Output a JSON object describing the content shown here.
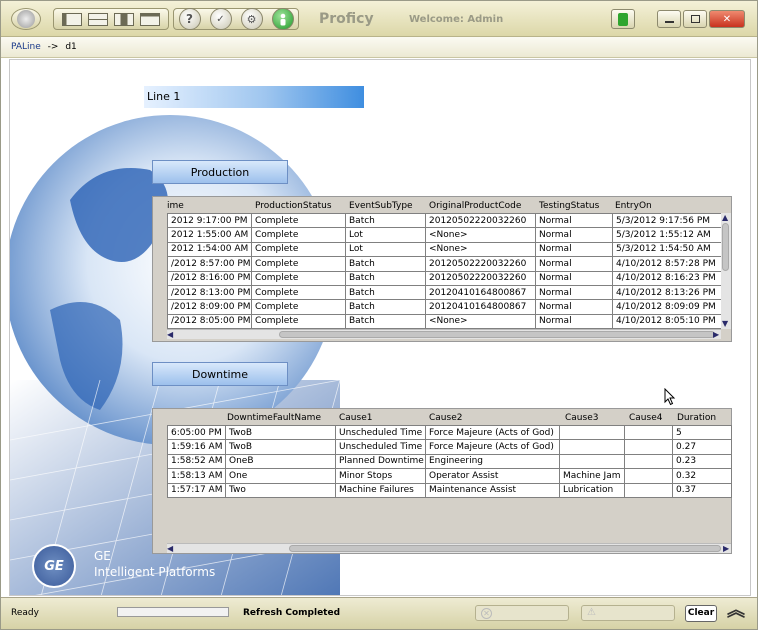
{
  "titlebar": {
    "brand": "Proficy",
    "welcome": "Welcome: Admin",
    "buttons": {
      "help": "?",
      "check": "✓",
      "gear": "⚙"
    }
  },
  "breadcrumb": {
    "root": "PALine",
    "separator": "->",
    "current": "d1"
  },
  "line_banner": "Line 1",
  "production": {
    "title": "Production",
    "columns": [
      "ime",
      "ProductionStatus",
      "EventSubType",
      "OriginalProductCode",
      "TestingStatus",
      "EntryOn"
    ],
    "rows": [
      [
        "2012 9:17:00 PM",
        "Complete",
        "Batch",
        "20120502220032260",
        "Normal",
        "5/3/2012 9:17:56 PM"
      ],
      [
        "2012 1:55:00 AM",
        "Complete",
        "Lot",
        "<None>",
        "Normal",
        "5/3/2012 1:55:12 AM"
      ],
      [
        "2012 1:54:00 AM",
        "Complete",
        "Lot",
        "<None>",
        "Normal",
        "5/3/2012 1:54:50 AM"
      ],
      [
        "/2012 8:57:00 PM",
        "Complete",
        "Batch",
        "20120502220032260",
        "Normal",
        "4/10/2012 8:57:28 PM"
      ],
      [
        "/2012 8:16:00 PM",
        "Complete",
        "Batch",
        "20120502220032260",
        "Normal",
        "4/10/2012 8:16:23 PM"
      ],
      [
        "/2012 8:13:00 PM",
        "Complete",
        "Batch",
        "20120410164800867",
        "Normal",
        "4/10/2012 8:13:26 PM"
      ],
      [
        "/2012 8:09:00 PM",
        "Complete",
        "Batch",
        "20120410164800867",
        "Normal",
        "4/10/2012 8:09:09 PM"
      ],
      [
        "/2012 8:05:00 PM",
        "Complete",
        "Batch",
        "<None>",
        "Normal",
        "4/10/2012 8:05:10 PM"
      ]
    ]
  },
  "downtime": {
    "title": "Downtime",
    "columns": [
      "",
      "DowntimeFaultName",
      "Cause1",
      "Cause2",
      "Cause3",
      "Cause4",
      "Duration"
    ],
    "rows": [
      [
        "6:05:00 PM",
        "TwoB",
        "Unscheduled Time",
        "Force Majeure (Acts of God)",
        "",
        "",
        "5"
      ],
      [
        "1:59:16 AM",
        "TwoB",
        "Unscheduled Time",
        "Force Majeure (Acts of God)",
        "",
        "",
        "0.27"
      ],
      [
        "1:58:52 AM",
        "OneB",
        "Planned Downtime",
        "Engineering",
        "",
        "",
        "0.23"
      ],
      [
        "1:58:13 AM",
        "One",
        "Minor Stops",
        "Operator Assist",
        "Machine Jam",
        "",
        "0.32"
      ],
      [
        "1:57:17 AM",
        "Two",
        "Machine Failures",
        "Maintenance Assist",
        "Lubrication",
        "",
        "0.37"
      ]
    ]
  },
  "logo": {
    "mark": "GE",
    "line1": "GE",
    "line2": "Intelligent Platforms"
  },
  "statusbar": {
    "status": "Ready",
    "message": "Refresh Completed",
    "clear": "Clear"
  },
  "colors": {
    "banner_accent": "#3f8ee0",
    "titlebar": "#dcd7a8",
    "green_icon": "#2fa52f",
    "close_red": "#c8321e"
  }
}
